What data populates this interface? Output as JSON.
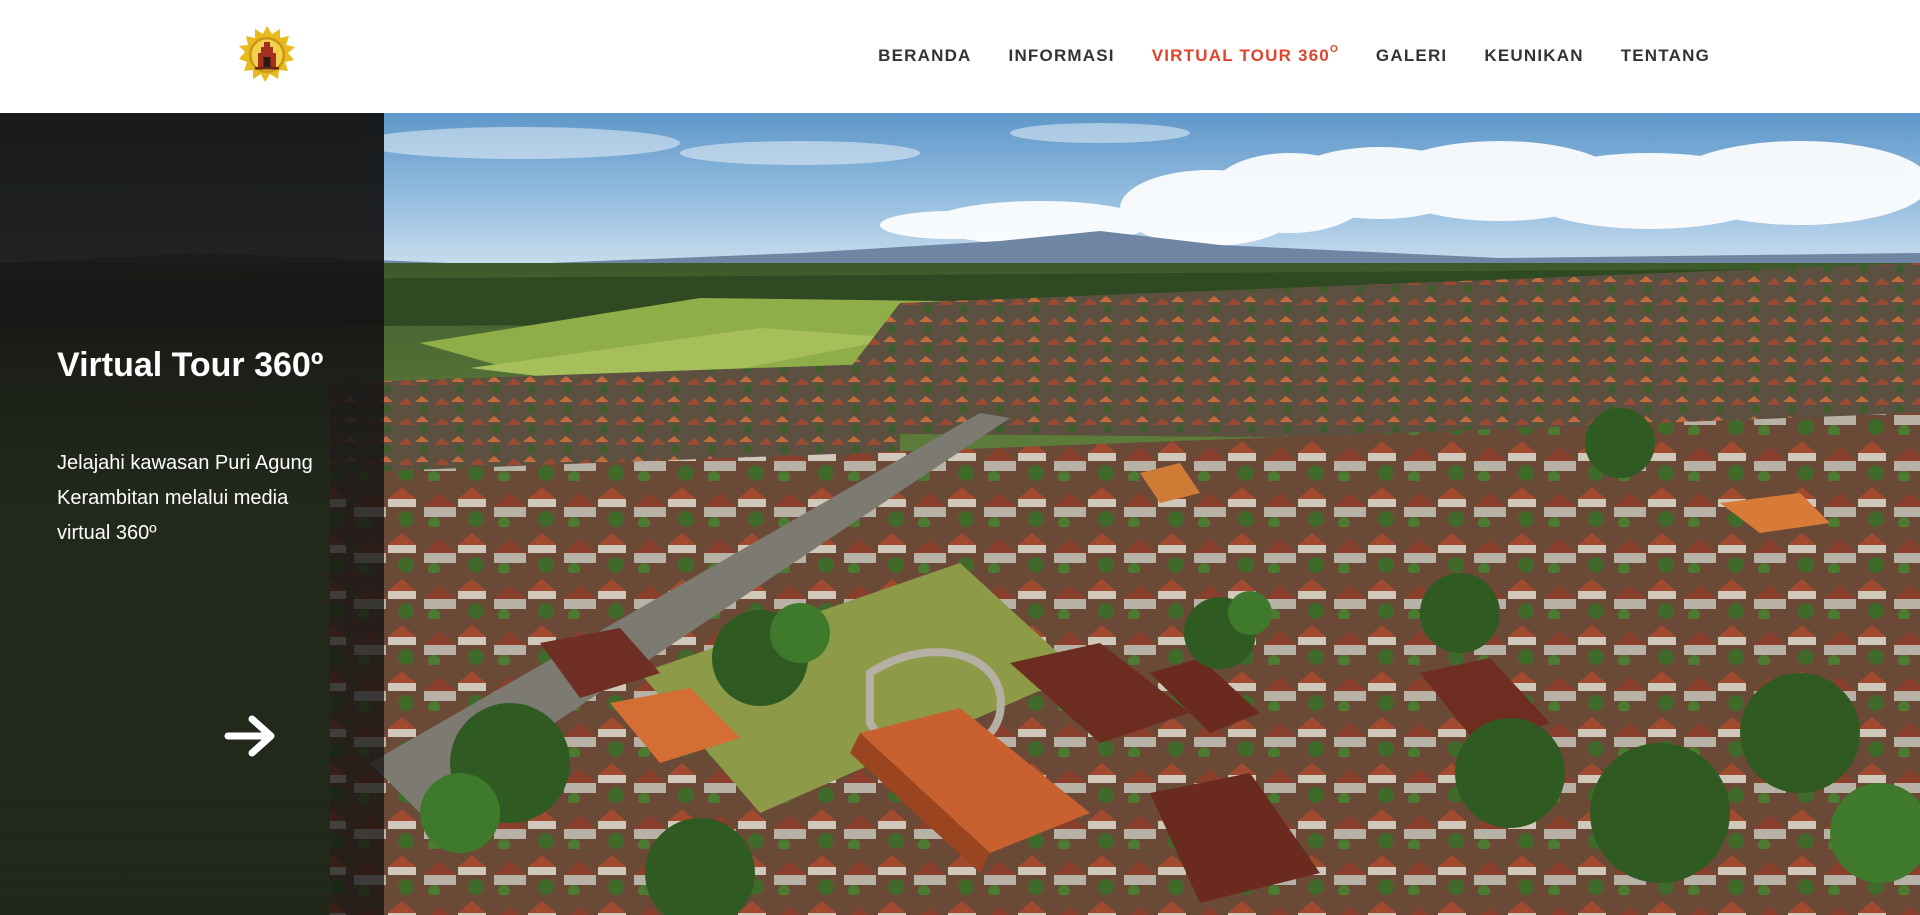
{
  "header": {
    "logo_icon": "puri-agung-emblem-icon",
    "nav": {
      "beranda": "BERANDA",
      "informasi": "INFORMASI",
      "virtual_tour": "VIRTUAL TOUR 360",
      "virtual_tour_degree": "O",
      "galeri": "GALERI",
      "keunikan": "KEUNIKAN",
      "tentang": "TENTANG"
    },
    "active_item": "virtual_tour"
  },
  "hero": {
    "title": "Virtual Tour 360º",
    "description": "Jelajahi kawasan Puri Agung Kerambitan melalui media virtual 360º",
    "next_icon": "arrow-right-icon"
  },
  "colors": {
    "accent": "#e0442c",
    "nav_text": "#333333",
    "panel_bg": "#141414",
    "panel_text": "#ffffff"
  }
}
